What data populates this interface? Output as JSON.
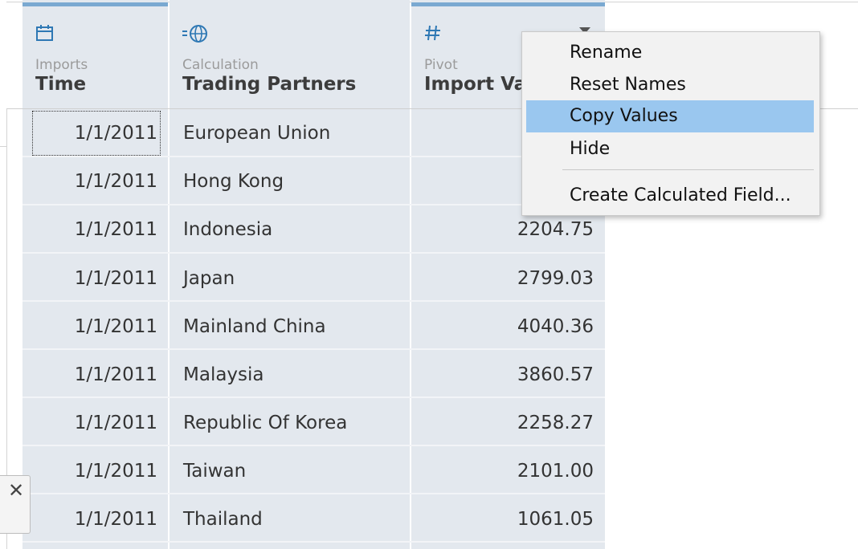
{
  "columns": [
    {
      "type_label": "Imports",
      "title": "Time",
      "icon": "calendar-icon"
    },
    {
      "type_label": "Calculation",
      "title": "Trading Partners",
      "icon": "globe-calc-icon"
    },
    {
      "type_label": "Pivot",
      "title": "Import Value",
      "icon": "hash-icon"
    }
  ],
  "rows": [
    {
      "time": "1/1/2011",
      "partner": "European Union",
      "value": ""
    },
    {
      "time": "1/1/2011",
      "partner": "Hong Kong",
      "value": ""
    },
    {
      "time": "1/1/2011",
      "partner": "Indonesia",
      "value": "2204.75"
    },
    {
      "time": "1/1/2011",
      "partner": "Japan",
      "value": "2799.03"
    },
    {
      "time": "1/1/2011",
      "partner": "Mainland China",
      "value": "4040.36"
    },
    {
      "time": "1/1/2011",
      "partner": "Malaysia",
      "value": "3860.57"
    },
    {
      "time": "1/1/2011",
      "partner": "Republic Of Korea",
      "value": "2258.27"
    },
    {
      "time": "1/1/2011",
      "partner": "Taiwan",
      "value": "2101.00"
    },
    {
      "time": "1/1/2011",
      "partner": "Thailand",
      "value": "1061.05"
    }
  ],
  "context_menu": {
    "items": [
      "Rename",
      "Reset Names",
      "Copy Values",
      "Hide",
      "Create Calculated Field..."
    ],
    "active": "Copy Values"
  },
  "close_symbol": "✕",
  "colors": {
    "column_bg": "#e3e8ee",
    "accent_bar": "#7aa9d1",
    "icon_blue": "#2e78b4",
    "menu_highlight": "#9ac7ef"
  }
}
